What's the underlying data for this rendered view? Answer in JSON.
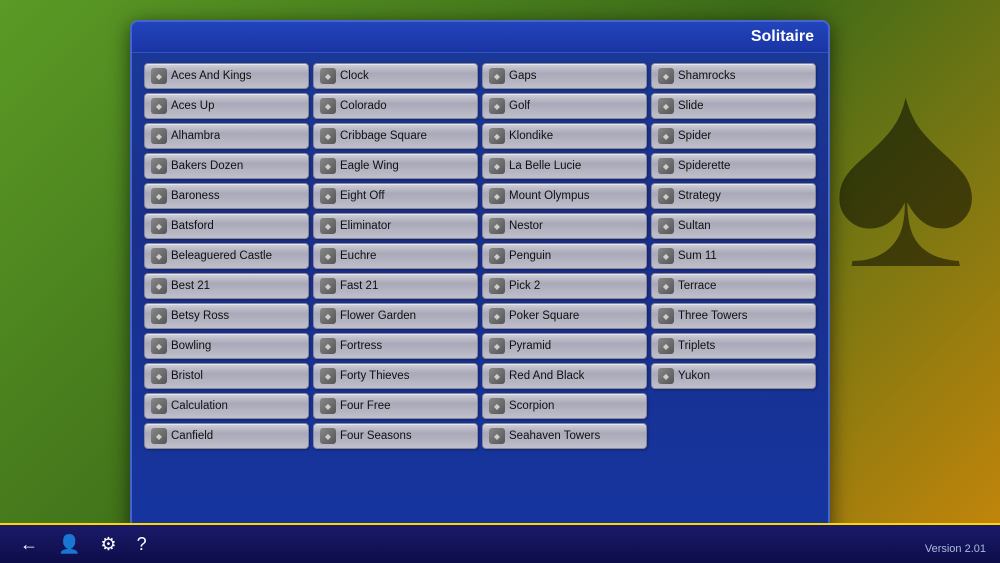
{
  "title": "Solitaire",
  "version": "Version 2.01",
  "games": [
    [
      "Aces And Kings",
      "Clock",
      "Gaps",
      "Shamrocks"
    ],
    [
      "Aces Up",
      "Colorado",
      "Golf",
      "Slide"
    ],
    [
      "Alhambra",
      "Cribbage Square",
      "Klondike",
      "Spider"
    ],
    [
      "Bakers Dozen",
      "Eagle Wing",
      "La Belle Lucie",
      "Spiderette"
    ],
    [
      "Baroness",
      "Eight Off",
      "Mount Olympus",
      "Strategy"
    ],
    [
      "Batsford",
      "Eliminator",
      "Nestor",
      "Sultan"
    ],
    [
      "Beleaguered Castle",
      "Euchre",
      "Penguin",
      "Sum 11"
    ],
    [
      "Best 21",
      "Fast 21",
      "Pick 2",
      "Terrace"
    ],
    [
      "Betsy Ross",
      "Flower Garden",
      "Poker Square",
      "Three Towers"
    ],
    [
      "Bowling",
      "Fortress",
      "Pyramid",
      "Triplets"
    ],
    [
      "Bristol",
      "Forty Thieves",
      "Red And Black",
      "Yukon"
    ],
    [
      "Calculation",
      "Four Free",
      "Scorpion",
      ""
    ],
    [
      "Canfield",
      "Four Seasons",
      "Seahaven Towers",
      ""
    ]
  ],
  "bottomIcons": [
    {
      "name": "back-icon",
      "symbol": "←"
    },
    {
      "name": "user-icon",
      "symbol": "👤"
    },
    {
      "name": "settings-icon",
      "symbol": "⚙"
    },
    {
      "name": "help-icon",
      "symbol": "?"
    }
  ]
}
